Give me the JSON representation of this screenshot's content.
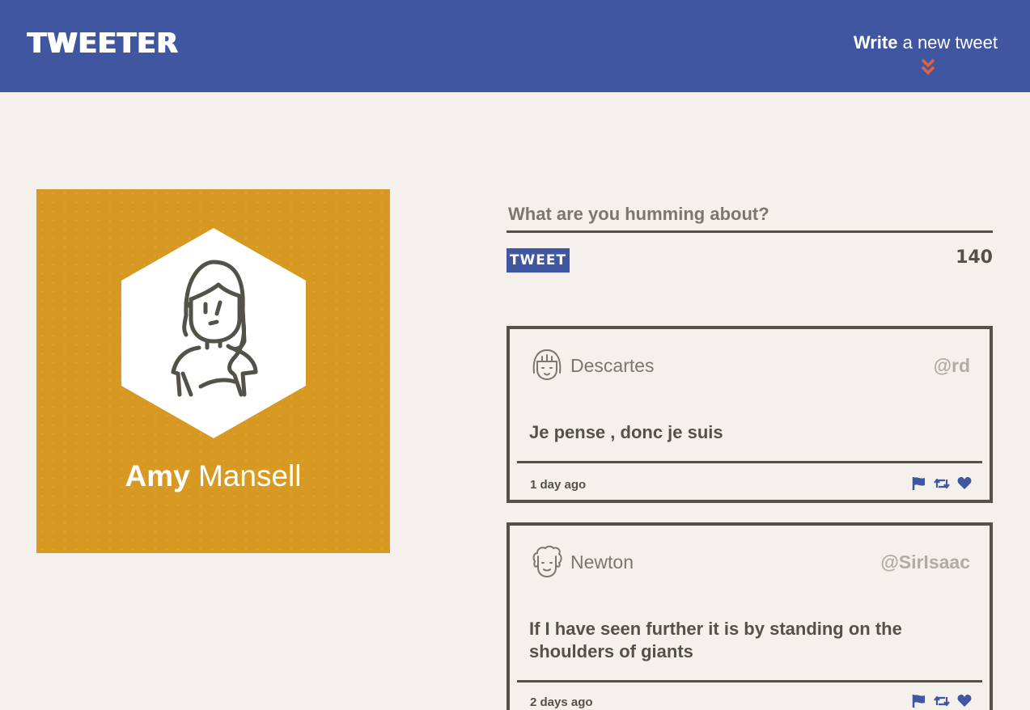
{
  "header": {
    "brand": "TWEETER",
    "compose_bold": "Write",
    "compose_rest": " a new tweet",
    "chevron_icon": "double-chevron-down-icon",
    "background": "#4056a1",
    "accent": "#e8613c"
  },
  "profile": {
    "first_name": "Amy",
    "last_name": "Mansell",
    "avatar_icon": "woman-avatar-icon",
    "card_color": "#d79922"
  },
  "composer": {
    "placeholder": "What are you humming about?",
    "button_label": "TWEET",
    "char_count": "140"
  },
  "tweets": [
    {
      "name": "Descartes",
      "handle": "@rd",
      "text": "Je pense , donc je suis",
      "age": "1 day ago",
      "avatar_icon": "girl-avatar-icon",
      "actions": [
        "flag-icon",
        "retweet-icon",
        "heart-icon"
      ]
    },
    {
      "name": "Newton",
      "handle": "@SirIsaac",
      "text": "If I have seen further it is by standing on the shoulders of giants",
      "age": "2 days ago",
      "avatar_icon": "curly-hair-avatar-icon",
      "actions": [
        "flag-icon",
        "retweet-icon",
        "heart-icon"
      ]
    }
  ]
}
